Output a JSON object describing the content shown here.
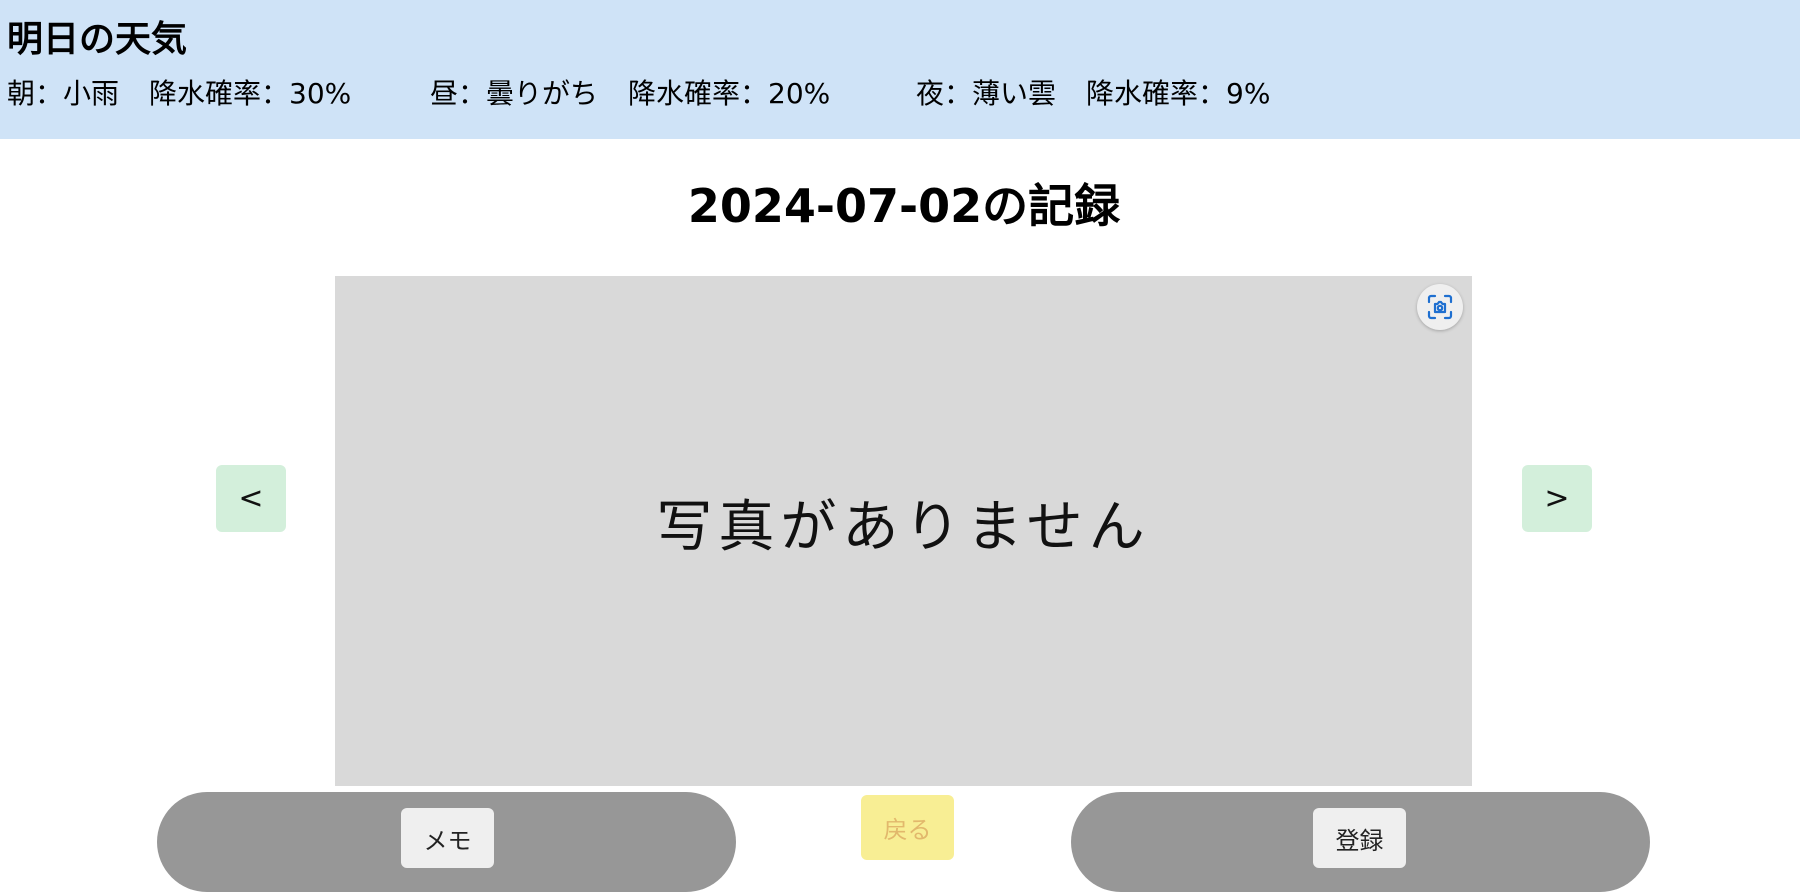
{
  "weather": {
    "title": "明日の天気",
    "forecasts": [
      {
        "label": "朝：小雨",
        "rain": "降水確率：30%"
      },
      {
        "label": "昼：曇りがち",
        "rain": "降水確率：20%"
      },
      {
        "label": "夜：薄い雲",
        "rain": "降水確率：9%"
      }
    ]
  },
  "record": {
    "title": "2024-07-02の記録"
  },
  "photo": {
    "empty_text": "写真がありません",
    "focus_icon": "focus-camera-icon",
    "accent_color": "#1e6fd0"
  },
  "nav": {
    "prev_label": "<",
    "next_label": ">"
  },
  "actions": {
    "memo_label": "メモ",
    "back_label": "戻る",
    "register_label": "登録"
  }
}
